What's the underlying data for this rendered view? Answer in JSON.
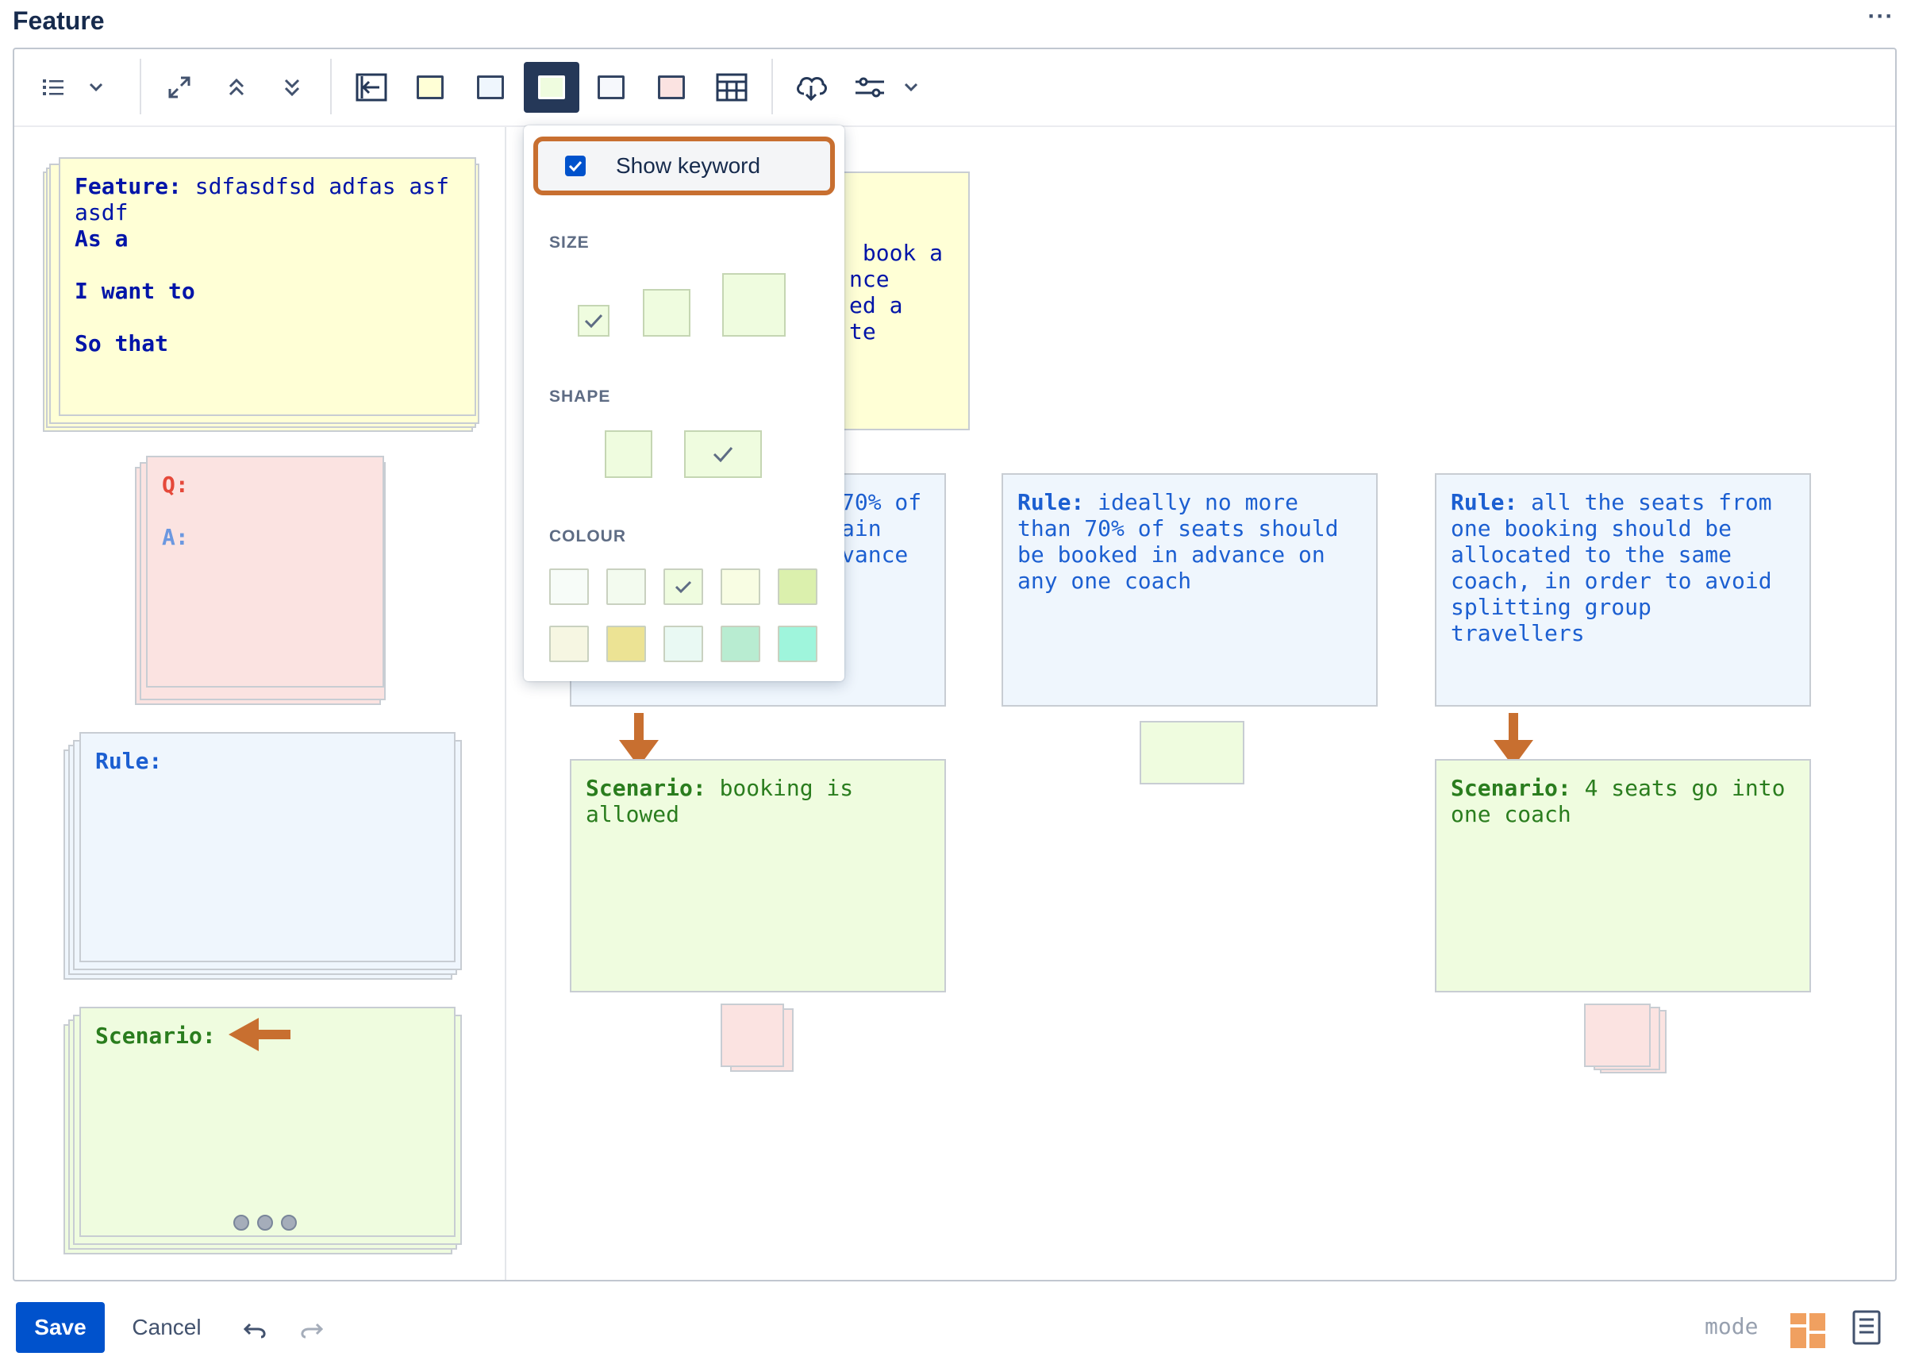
{
  "header": {
    "title": "Feature",
    "more_label": "···"
  },
  "toolbar": {
    "icons": [
      "list-icon",
      "chevron-down-icon",
      "expand-icon",
      "collapse-up-icon",
      "collapse-down-icon",
      "back-panel-icon",
      "yellow-card-icon",
      "blue-card-icon",
      "green-card-icon",
      "white-card-icon",
      "pink-card-icon",
      "table-icon",
      "cloud-download-icon",
      "settings-sliders-icon",
      "chevron-down-icon"
    ]
  },
  "colors": {
    "yellow": "#ffffd6",
    "pink": "#fbe3e1",
    "blue": "#eff6fd",
    "green": "#effcdf",
    "accent": "#0052cc",
    "arrow": "#c86f30"
  },
  "sidebar": {
    "feature_card": {
      "keyword": "Feature:",
      "title": " sdfasdfsd adfas asf\nasdf",
      "line1": "As a",
      "line2": "I want to",
      "line3": "So that"
    },
    "question_card": {
      "q": "Q:",
      "a": "A:"
    },
    "rule_card": {
      "keyword": "Rule:"
    },
    "scenario_card": {
      "keyword": "Scenario:"
    }
  },
  "board": {
    "feature_partial": [
      " book a",
      "nce",
      "ed a",
      "te"
    ],
    "rule1_partial": [
      "70% of",
      "ain",
      "vance"
    ],
    "rule2": {
      "keyword": "Rule:",
      "text": " ideally no more\nthan 70% of seats should\nbe booked in advance on\nany one coach"
    },
    "rule3": {
      "keyword": "Rule:",
      "text": " all the seats from\none booking should be\nallocated to the same\ncoach, in order to avoid\nsplitting group\ntravellers"
    },
    "scenario1": {
      "keyword": "Scenario:",
      "text": " booking is\nallowed"
    },
    "scenario3": {
      "keyword": "Scenario:",
      "text": " 4 seats go into\none coach"
    }
  },
  "popup": {
    "show_keyword_label": "Show keyword",
    "show_keyword_checked": true,
    "size_title": "SIZE",
    "shape_title": "SHAPE",
    "colour_title": "COLOUR",
    "selected_size": "small",
    "selected_shape": "wide",
    "selected_colour_index": 2,
    "colour_swatches": [
      "#f7fcf8",
      "#f3fbef",
      "#effcdf",
      "#f8fde3",
      "#dbf0ad",
      "#f6f6e2",
      "#ece394",
      "#e9f9f3",
      "#b8ecd1",
      "#9ff5dc"
    ]
  },
  "footer": {
    "save_label": "Save",
    "cancel_label": "Cancel",
    "mode_label": "mode"
  }
}
